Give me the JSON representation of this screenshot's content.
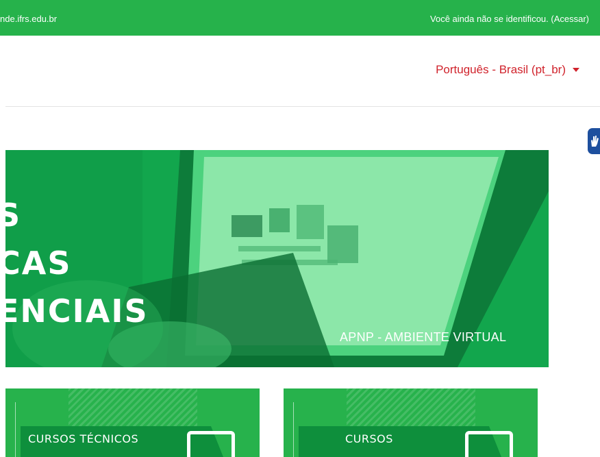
{
  "topbar": {
    "site_text": "nde.ifrs.edu.br",
    "login_text": "Você ainda não se identificou. (Acessar)"
  },
  "language": {
    "selected": "Português - Brasil (pt_br)"
  },
  "accessibility": {
    "icon": "vlibras-hand-icon"
  },
  "banner": {
    "lines": [
      "S",
      "CAS",
      "ENCIAIS"
    ],
    "caption": "APNP - AMBIENTE VIRTUAL"
  },
  "cards": [
    {
      "label": "CURSOS TÉCNICOS"
    },
    {
      "label": "CURSOS"
    }
  ],
  "colors": {
    "brand_green": "#26b24b",
    "language_red": "#d0222b",
    "vlibras_blue": "#1d4f9e"
  }
}
